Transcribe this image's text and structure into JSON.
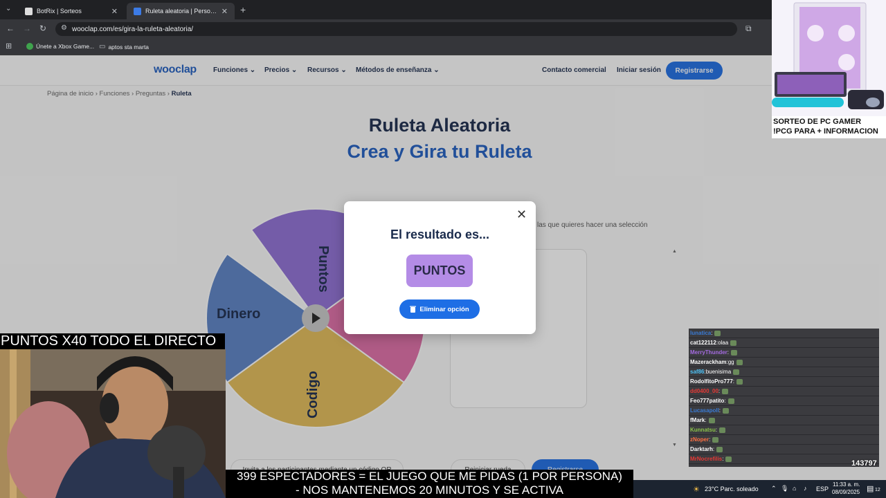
{
  "browser": {
    "tabs": [
      {
        "title": "BotRix | Sorteos",
        "active": false
      },
      {
        "title": "Ruleta aleatoria | Personaliza y",
        "active": true
      }
    ],
    "url": "wooclap.com/es/gira-la-ruleta-aleatoria/",
    "bookmarks": [
      "Únete a Xbox Game...",
      "aptos sta marta"
    ]
  },
  "site": {
    "logo": "wooclap",
    "nav": [
      "Funciones",
      "Precios",
      "Recursos",
      "Métodos de enseñanza"
    ],
    "contact": "Contacto comercial",
    "login": "Iniciar sesión",
    "signup": "Registrarse",
    "breadcrumb": [
      "Página de inicio",
      "Funciones",
      "Preguntas",
      "Ruleta"
    ],
    "title": "Ruleta Aleatoria",
    "subtitle": "Crea y Gira tu Ruleta",
    "hint": "las que quieres hacer una selección",
    "wheel_segments": [
      {
        "label": "Puntos",
        "color": "#8f6fd6"
      },
      {
        "label": "Dinero",
        "color": "#5b82c6"
      },
      {
        "label": "Codigo",
        "color": "#e3bc58"
      },
      {
        "label": "",
        "color": "#e06ea8"
      }
    ],
    "bottom_left": "Invita a los participantes mediante un código QR",
    "bottom_mid": "Reiniciar rueda",
    "bottom_right": "Registrarse"
  },
  "modal": {
    "title": "El resultado es...",
    "result": "PUNTOS",
    "delete_label": "Eliminar opción"
  },
  "stream": {
    "promo_line1": "SORTEO DE PC GAMER",
    "promo_line2": "!PCG PARA + INFORMACION",
    "points_banner": "PUNTOS X40 TODO EL DIRECTO",
    "caption_line1": "399 ESPECTADORES = EL JUEGO QUE ME PIDAS (1 POR PERSONA)",
    "caption_line2": "- NOS MANTENEMOS 20 MINUTOS Y SE ACTIVA",
    "viewers": "143797",
    "chat": [
      {
        "user": "lunatica",
        "msg": "",
        "color": "#3a7bd5"
      },
      {
        "user": "cat122112",
        "msg": "olaa",
        "color": "#ffffff"
      },
      {
        "user": "MerryThunder",
        "msg": "",
        "color": "#a46be0"
      },
      {
        "user": "Mazerackham",
        "msg": "gg",
        "color": "#ffffff"
      },
      {
        "user": "saf86",
        "msg": "buenisima",
        "color": "#4fc3f7"
      },
      {
        "user": "RodolfitoPro777",
        "msg": "",
        "color": "#ffffff"
      },
      {
        "user": "dd0400_00",
        "msg": "",
        "color": "#e53935"
      },
      {
        "user": "Feo777patito",
        "msg": "",
        "color": "#ffffff"
      },
      {
        "user": "Lucasapoll",
        "msg": "",
        "color": "#3a7bd5"
      },
      {
        "user": "fMark",
        "msg": "",
        "color": "#ffffff"
      },
      {
        "user": "Kunnatsu",
        "msg": "",
        "color": "#8bc34a"
      },
      {
        "user": "zNoper",
        "msg": "",
        "color": "#ff7043"
      },
      {
        "user": "Darktarh",
        "msg": "",
        "color": "#ffffff"
      },
      {
        "user": "MrNocrefilis",
        "msg": "",
        "color": "#e53935"
      }
    ]
  },
  "taskbar": {
    "weather": "23°C  Parc. soleado",
    "lang": "ESP",
    "time": "11:33 a. m.",
    "date": "08/09/2025",
    "notif_count": "12"
  }
}
